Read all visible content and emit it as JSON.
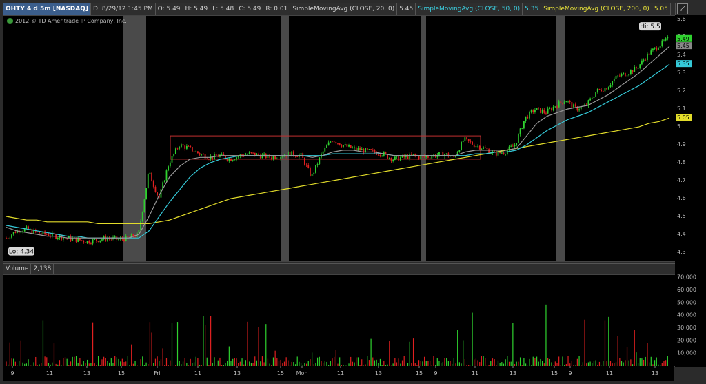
{
  "header": {
    "symbol": "OHTY 4 d 5m [NASDAQ]",
    "date": "D: 8/29/12 1:45 PM",
    "open": "O: 5.49",
    "high": "H: 5.49",
    "low": "L: 5.48",
    "close": "C: 5.49",
    "range": "R: 0.01",
    "sma20_label": "SimpleMovingAvg (CLOSE, 20, 0)",
    "sma20_value": "5.45",
    "sma50_label": "SimpleMovingAvg (CLOSE, 50, 0)",
    "sma50_value": "5.35",
    "sma200_label": "SimpleMovingAvg (CLOSE, 200, 0)",
    "sma200_value": "5.05"
  },
  "copyright": "2012 © TD Ameritrade IP Company, Inc.",
  "volume_header": {
    "label": "Volume",
    "value": "2,138"
  },
  "colors": {
    "up": "#2fd22f",
    "down": "#e02020",
    "sma20": "#9a9a9a",
    "sma50": "#35c9d8",
    "sma200": "#e2dc2a",
    "shade": "#4a4a4a",
    "channel": "#c03030"
  },
  "chart_data": [
    {
      "type": "candlestick",
      "title": "OHTY 4 d 5m [NASDAQ]",
      "y_ticks": [
        "5.6",
        "5.5",
        "5.4",
        "5.3",
        "5.2",
        "5.1",
        "5",
        "4.9",
        "4.8",
        "4.7",
        "4.6",
        "4.5",
        "4.4",
        "4.3"
      ],
      "ylim": [
        4.25,
        5.62
      ],
      "x_ticks": [
        "9",
        "11",
        "13",
        "15",
        "Fri",
        "11",
        "13",
        "15",
        "Mon",
        "11",
        "13",
        "15",
        "9",
        "11",
        "13",
        "15",
        "9",
        "11",
        "13"
      ],
      "annotations": {
        "high": "Hi: 5.5",
        "low": "Lo: 4.34"
      },
      "price_labels": {
        "last": "5.49",
        "sma20": "5.45",
        "sma50": "5.35",
        "sma200": "5.05"
      },
      "close_path": [
        4.38,
        4.42,
        4.43,
        4.41,
        4.4,
        4.39,
        4.38,
        4.37,
        4.36,
        4.37,
        4.38,
        4.37,
        4.38,
        4.4,
        4.75,
        4.6,
        4.8,
        4.9,
        4.88,
        4.85,
        4.83,
        4.84,
        4.82,
        4.84,
        4.85,
        4.84,
        4.83,
        4.84,
        4.85,
        4.84,
        4.72,
        4.85,
        4.93,
        4.9,
        4.88,
        4.87,
        4.86,
        4.85,
        4.82,
        4.83,
        4.84,
        4.83,
        4.84,
        4.85,
        4.83,
        4.93,
        4.9,
        4.88,
        4.85,
        4.86,
        4.9,
        5.05,
        5.1,
        5.08,
        5.12,
        5.15,
        5.1,
        5.12,
        5.2,
        5.22,
        5.28,
        5.3,
        5.33,
        5.4,
        5.45,
        5.49
      ],
      "sma20": [
        4.44,
        4.42,
        4.41,
        4.4,
        4.39,
        4.39,
        4.38,
        4.38,
        4.38,
        4.38,
        4.38,
        4.38,
        4.38,
        4.4,
        4.5,
        4.62,
        4.72,
        4.78,
        4.82,
        4.83,
        4.83,
        4.84,
        4.84,
        4.84,
        4.84,
        4.84,
        4.84,
        4.84,
        4.84,
        4.84,
        4.83,
        4.84,
        4.86,
        4.87,
        4.87,
        4.86,
        4.86,
        4.85,
        4.84,
        4.84,
        4.84,
        4.84,
        4.84,
        4.84,
        4.84,
        4.86,
        4.87,
        4.87,
        4.87,
        4.87,
        4.88,
        4.95,
        5.02,
        5.06,
        5.08,
        5.1,
        5.11,
        5.12,
        5.15,
        5.18,
        5.22,
        5.26,
        5.3,
        5.35,
        5.4,
        5.45
      ],
      "sma50": [
        4.45,
        4.44,
        4.43,
        4.42,
        4.41,
        4.4,
        4.39,
        4.39,
        4.38,
        4.38,
        4.38,
        4.38,
        4.38,
        4.38,
        4.42,
        4.5,
        4.58,
        4.65,
        4.72,
        4.77,
        4.8,
        4.82,
        4.83,
        4.84,
        4.84,
        4.84,
        4.84,
        4.84,
        4.84,
        4.84,
        4.84,
        4.84,
        4.85,
        4.85,
        4.85,
        4.85,
        4.85,
        4.85,
        4.84,
        4.84,
        4.84,
        4.84,
        4.84,
        4.84,
        4.84,
        4.84,
        4.85,
        4.85,
        4.86,
        4.86,
        4.87,
        4.9,
        4.94,
        4.98,
        5.01,
        5.04,
        5.06,
        5.08,
        5.11,
        5.14,
        5.17,
        5.2,
        5.23,
        5.27,
        5.31,
        5.35
      ],
      "sma200": [
        4.5,
        4.49,
        4.48,
        4.48,
        4.47,
        4.47,
        4.47,
        4.47,
        4.47,
        4.46,
        4.46,
        4.46,
        4.46,
        4.46,
        4.46,
        4.47,
        4.48,
        4.5,
        4.52,
        4.54,
        4.56,
        4.58,
        4.6,
        4.61,
        4.62,
        4.63,
        4.64,
        4.65,
        4.66,
        4.67,
        4.68,
        4.69,
        4.7,
        4.71,
        4.72,
        4.73,
        4.74,
        4.75,
        4.76,
        4.77,
        4.78,
        4.79,
        4.8,
        4.81,
        4.82,
        4.83,
        4.84,
        4.85,
        4.86,
        4.87,
        4.88,
        4.89,
        4.9,
        4.91,
        4.92,
        4.93,
        4.94,
        4.95,
        4.96,
        4.97,
        4.98,
        4.99,
        5.0,
        5.02,
        5.03,
        5.05
      ],
      "channel": {
        "top": 4.95,
        "bottom": 4.82
      }
    },
    {
      "type": "bar",
      "title": "Volume",
      "y_ticks": [
        "70,000",
        "60,000",
        "50,000",
        "40,000",
        "30,000",
        "20,000",
        "10,000"
      ],
      "ylim": [
        0,
        72000
      ]
    }
  ]
}
